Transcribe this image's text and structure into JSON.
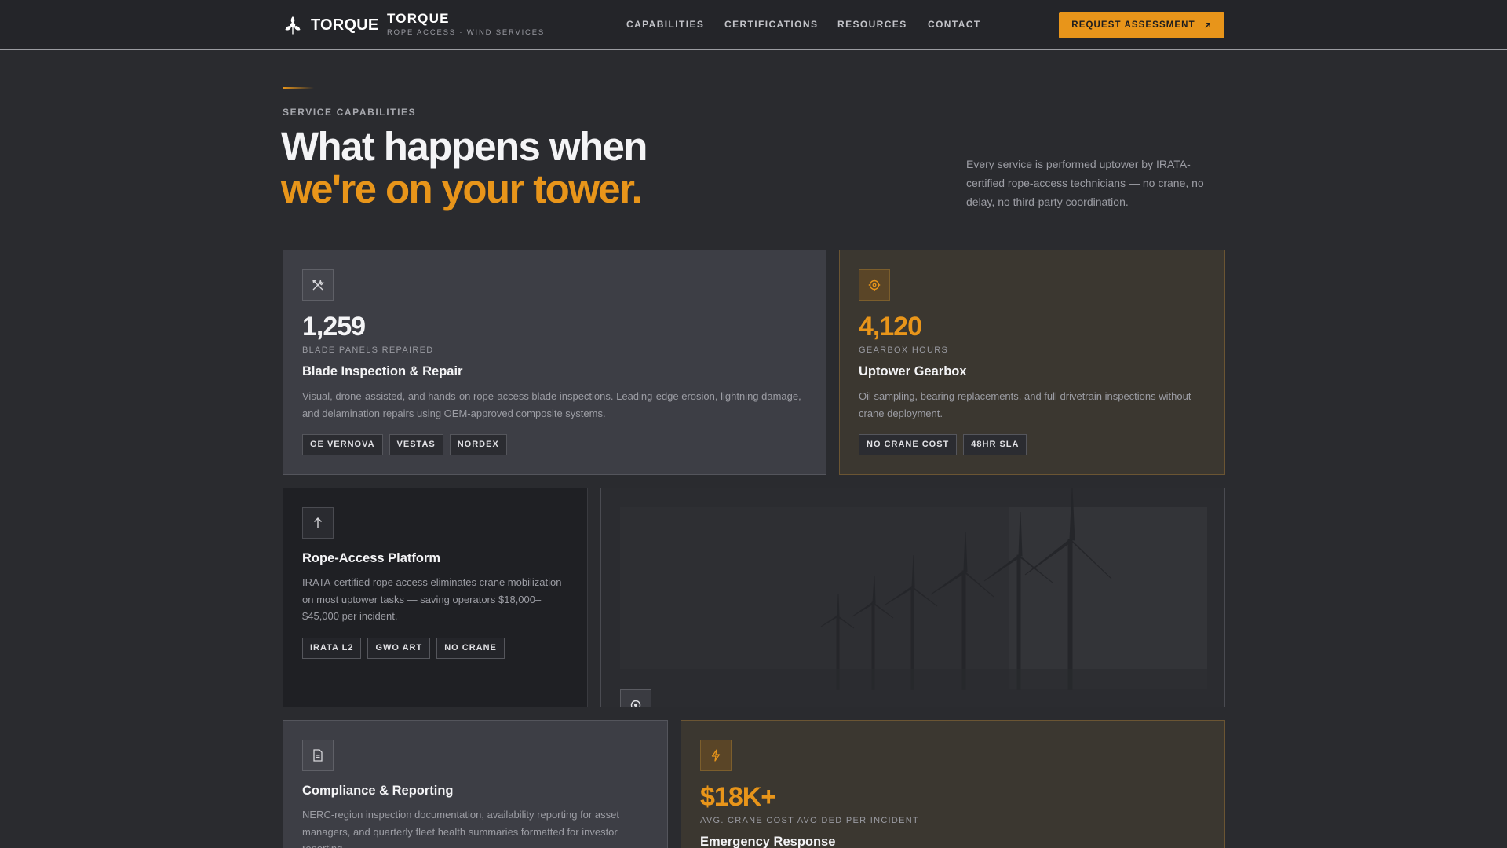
{
  "nav": {
    "logo_text": "TORQUE",
    "brand_name": "TORQUE",
    "brand_sub": "ROPE ACCESS · WIND SERVICES",
    "links": [
      "CAPABILITIES",
      "CERTIFICATIONS",
      "RESOURCES",
      "CONTACT"
    ],
    "cta_label": "REQUEST ASSESSMENT",
    "cta_icon": "arrow-up-right-icon"
  },
  "hero": {
    "eyebrow": "SERVICE CAPABILITIES",
    "title_line1": "What happens when",
    "title_line2": "we're on your tower.",
    "description": "Every service is performed uptower by IRATA-certified rope-access technicians — no crane, no delay, no third-party coordination."
  },
  "cards": {
    "blade": {
      "icon": "tools-icon",
      "stat": "1,259",
      "stat_label": "BLADE PANELS REPAIRED",
      "title": "Blade Inspection & Repair",
      "description": "Visual, drone-assisted, and hands-on rope-access blade inspections. Leading-edge erosion, lightning damage, and delamination repairs using OEM-approved composite systems.",
      "tags": [
        "GE VERNOVA",
        "VESTAS",
        "NORDEX"
      ]
    },
    "gearbox": {
      "icon": "gear-icon",
      "stat": "4,120",
      "stat_label": "GEARBOX HOURS",
      "title": "Uptower Gearbox",
      "description": "Oil sampling, bearing replacements, and full drivetrain inspections without crane deployment.",
      "tags": [
        "NO CRANE COST",
        "48HR SLA"
      ]
    },
    "rope": {
      "icon": "arrow-up-icon",
      "title": "Rope-Access Platform",
      "description": "IRATA-certified rope access eliminates crane mobilization on most uptower tasks — saving operators $18,000–$45,000 per incident.",
      "tags": [
        "IRATA L2",
        "GWO ART",
        "NO CRANE"
      ]
    },
    "image": {
      "icon": "location-pin-icon"
    },
    "compliance": {
      "icon": "document-icon",
      "title": "Compliance & Reporting",
      "description": "NERC-region inspection documentation, availability reporting for asset managers, and quarterly fleet health summaries formatted for investor reporting."
    },
    "emergency": {
      "icon": "lightning-icon",
      "stat": "$18K+",
      "stat_label": "AVG. CRANE COST AVOIDED PER INCIDENT",
      "title": "Emergency Response"
    }
  },
  "colors": {
    "accent": "#e8951a",
    "background": "#2a2b2f",
    "nav_background": "#242529"
  }
}
